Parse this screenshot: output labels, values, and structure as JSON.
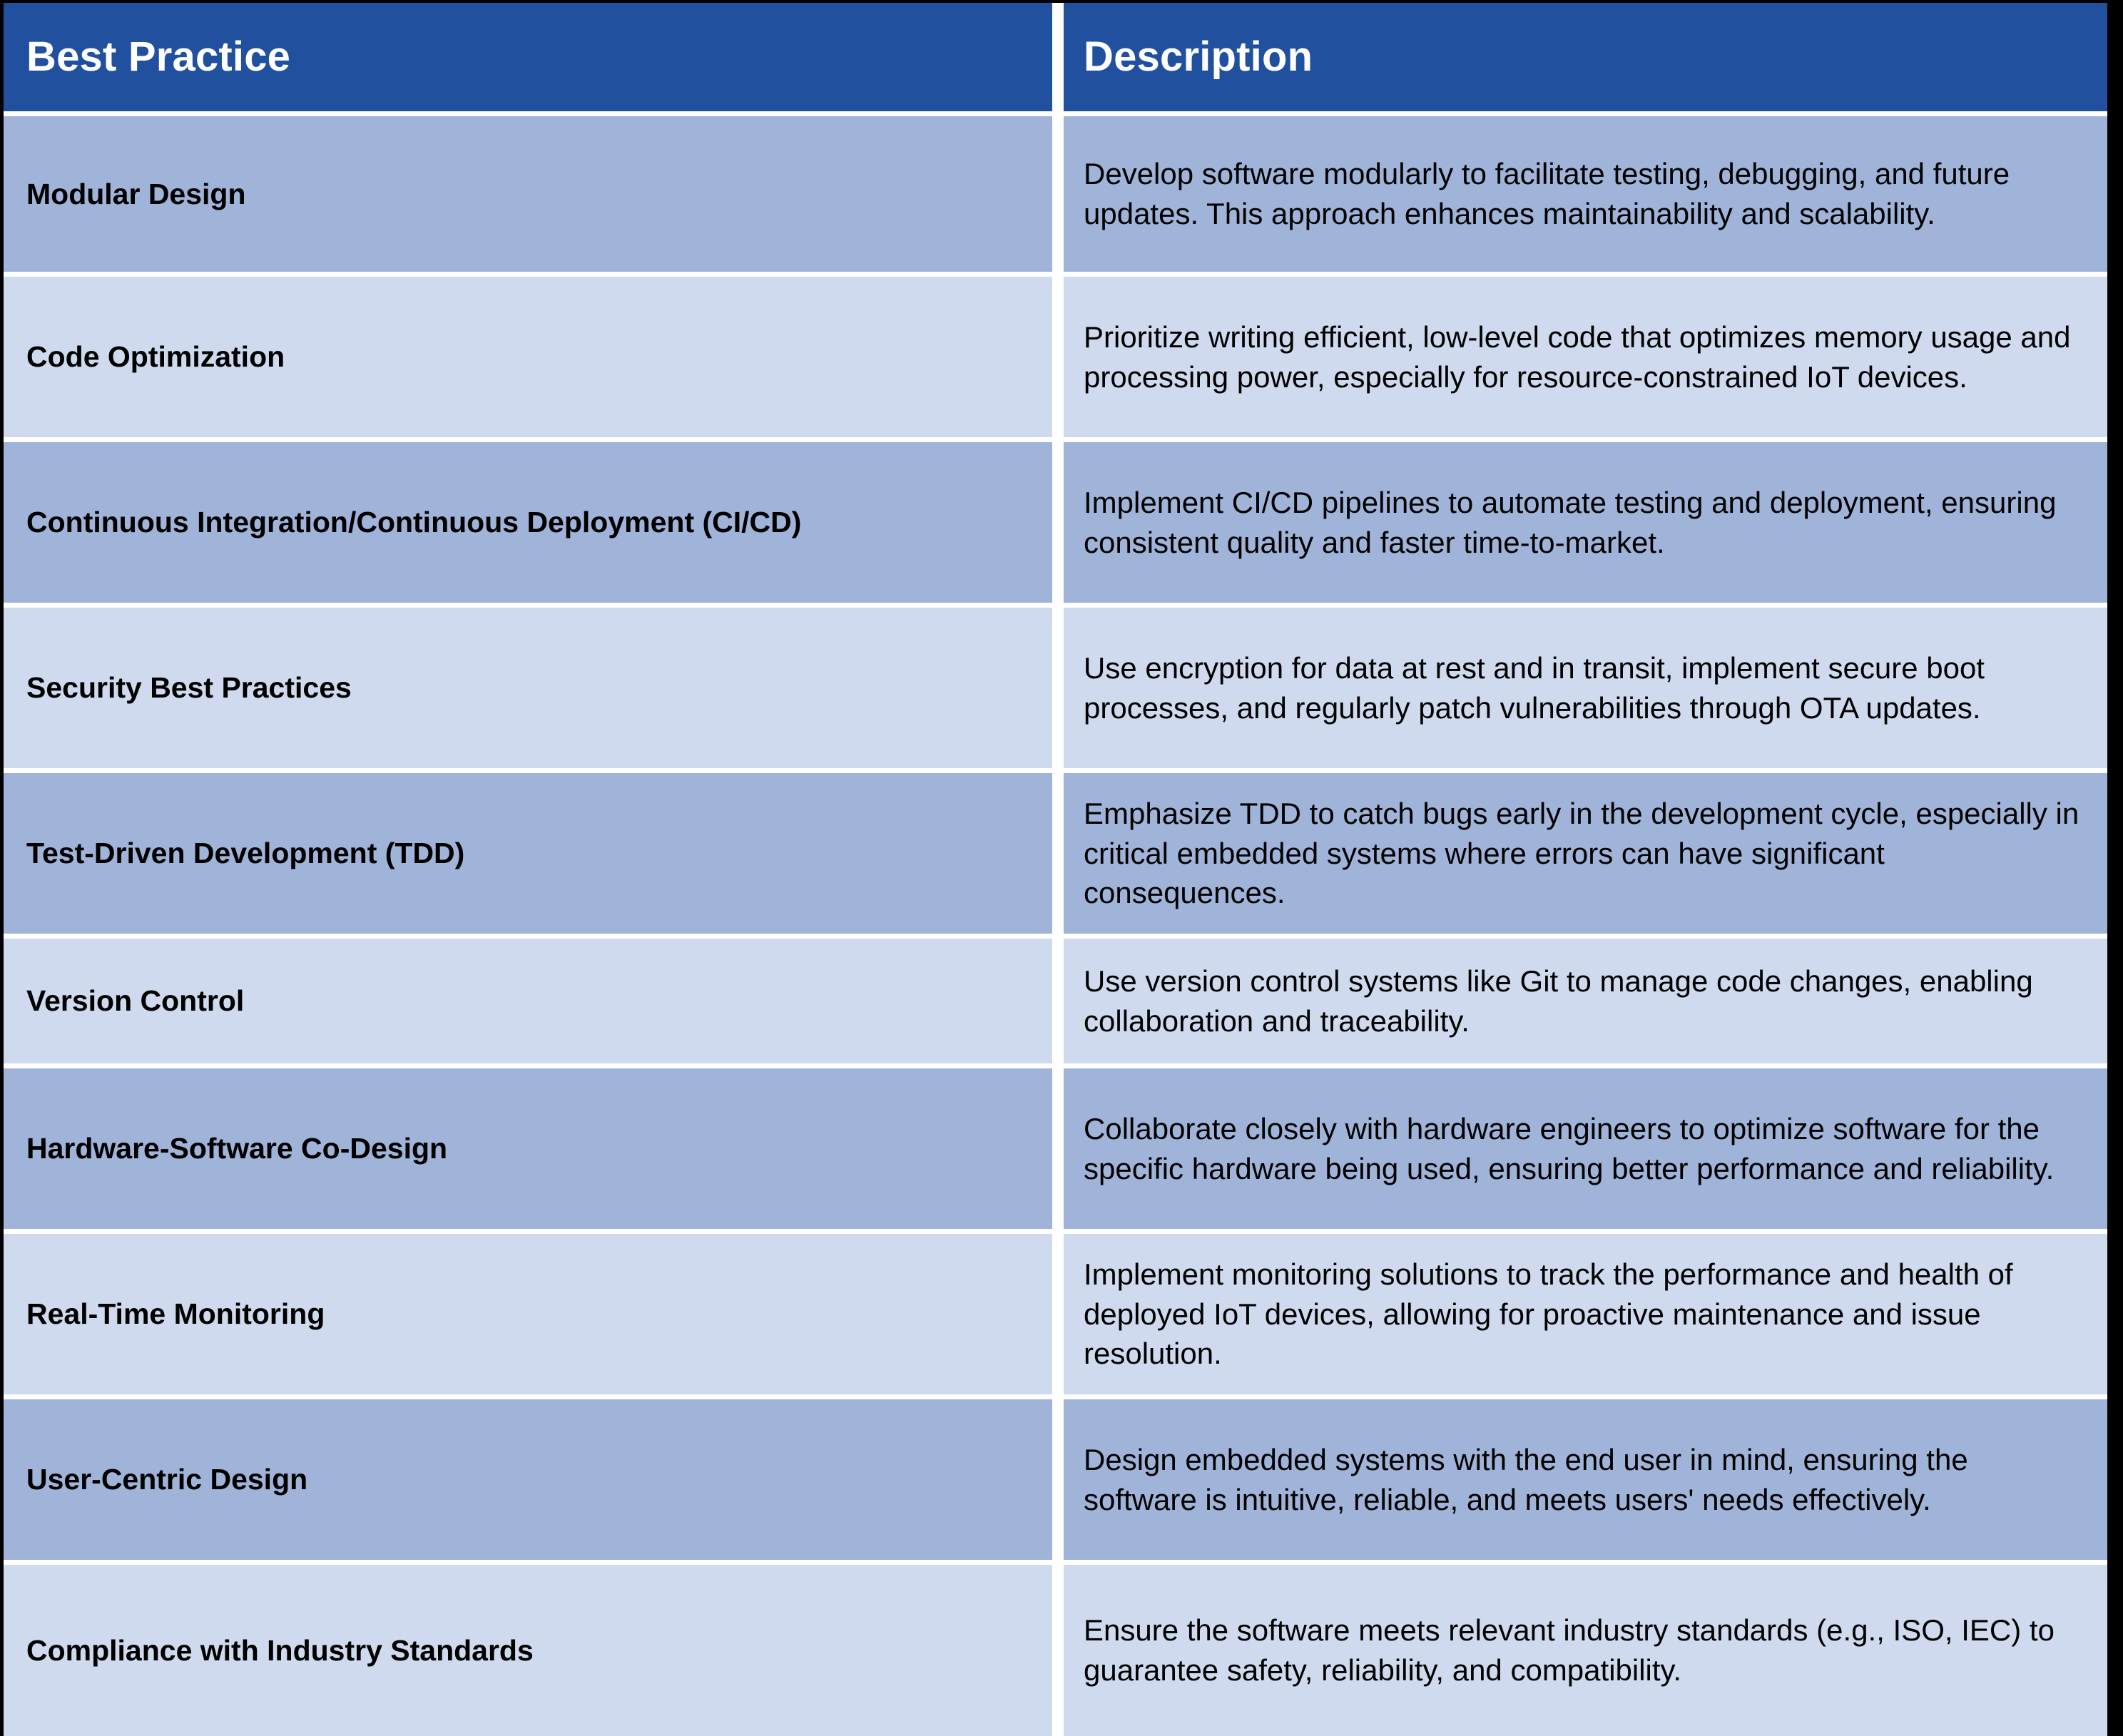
{
  "table": {
    "columns": [
      {
        "key": "practice",
        "header": "Best Practice"
      },
      {
        "key": "description",
        "header": "Description"
      }
    ],
    "colors": {
      "header_background": "#20509E",
      "header_text": "#FFFFFF",
      "row_shade_dark": "#9FB4D8",
      "row_shade_light": "#CFDAEE",
      "grid_gap": "#FFFFFF",
      "frame": "#000000",
      "body_text": "#000000"
    },
    "rows": [
      {
        "practice": "Modular Design",
        "description": "Develop software modularly to facilitate testing, debugging, and future updates. This approach enhances maintainability and scalability."
      },
      {
        "practice": "Code Optimization",
        "description": "Prioritize writing efficient, low-level code that optimizes memory usage and processing power, especially for resource-constrained IoT devices."
      },
      {
        "practice": "Continuous Integration/Continuous Deployment (CI/CD)",
        "description": "Implement CI/CD pipelines to automate testing and deployment, ensuring consistent quality and faster time-to-market."
      },
      {
        "practice": "Security Best Practices",
        "description": "Use encryption for data at rest and in transit, implement secure boot processes, and regularly patch vulnerabilities through OTA updates."
      },
      {
        "practice": "Test-Driven Development (TDD)",
        "description": "Emphasize TDD to catch bugs early in the development cycle, especially in critical embedded systems where errors can have significant consequences."
      },
      {
        "practice": "Version Control",
        "description": "Use version control systems like Git to manage code changes, enabling collaboration and traceability."
      },
      {
        "practice": "Hardware-Software Co-Design",
        "description": "Collaborate closely with hardware engineers to optimize software for the specific hardware being used, ensuring better performance and reliability."
      },
      {
        "practice": "Real-Time Monitoring",
        "description": "Implement monitoring solutions to track the performance and health of deployed IoT devices, allowing for proactive maintenance and issue resolution."
      },
      {
        "practice": "User-Centric Design",
        "description": "Design embedded systems with the end user in mind, ensuring the software is intuitive, reliable, and meets users' needs effectively."
      },
      {
        "practice": "Compliance with Industry Standards",
        "description": "Ensure the software meets relevant industry standards (e.g., ISO, IEC) to guarantee safety, reliability,  and compatibility."
      }
    ]
  }
}
